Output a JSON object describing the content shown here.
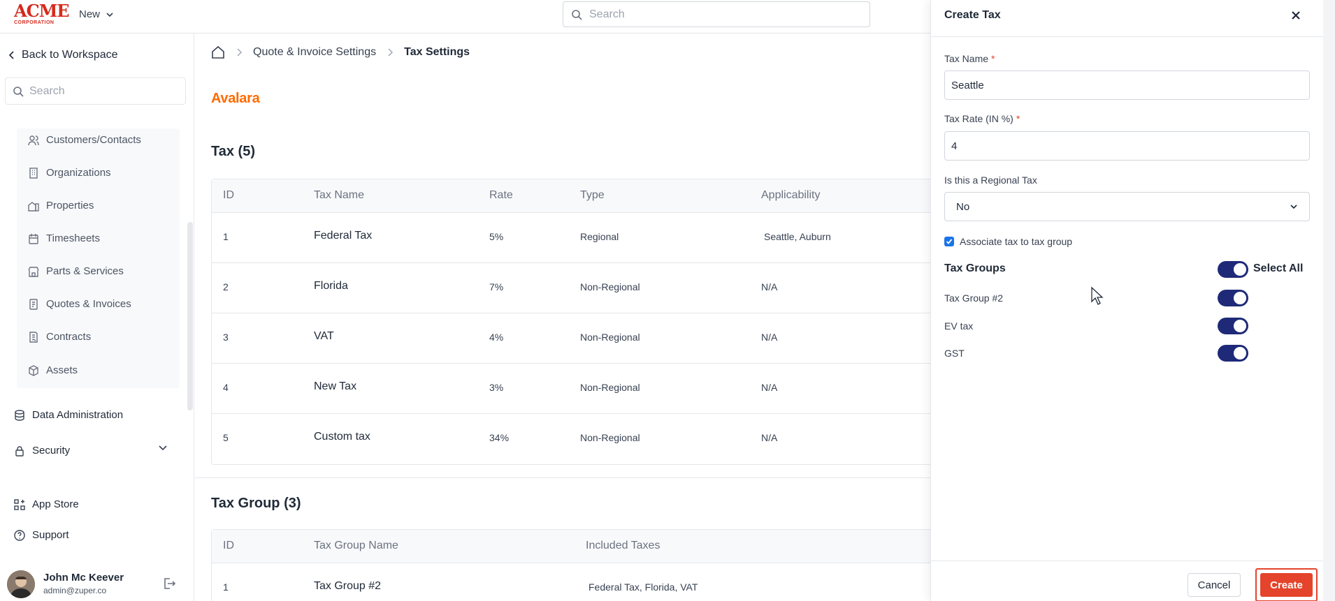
{
  "app": {
    "logo_main": "ACME",
    "logo_sub": "CORPORATION",
    "new_label": "New",
    "search_placeholder": "Search"
  },
  "sidebar": {
    "back_label": "Back to Workspace",
    "search_placeholder": "Search",
    "items": [
      {
        "label": "Customers/Contacts",
        "icon": "users-icon"
      },
      {
        "label": "Organizations",
        "icon": "building-icon"
      },
      {
        "label": "Properties",
        "icon": "property-icon"
      },
      {
        "label": "Timesheets",
        "icon": "calendar-icon"
      },
      {
        "label": "Parts & Services",
        "icon": "store-icon"
      },
      {
        "label": "Quotes & Invoices",
        "icon": "invoice-icon"
      },
      {
        "label": "Contracts",
        "icon": "contract-icon"
      },
      {
        "label": "Assets",
        "icon": "cube-icon"
      }
    ],
    "data_admin_label": "Data Administration",
    "security_label": "Security",
    "app_store_label": "App Store",
    "support_label": "Support",
    "user": {
      "name": "John Mc Keever",
      "email": "admin@zuper.co"
    }
  },
  "breadcrumb": {
    "items": [
      "Quote & Invoice Settings",
      "Tax Settings"
    ]
  },
  "main": {
    "brand": "Avalara",
    "tax_section_title": "Tax (5)",
    "tax_columns": [
      "ID",
      "Tax Name",
      "Rate",
      "Type",
      "Applicability"
    ],
    "tax_rows": [
      {
        "id": "1",
        "name": "Federal Tax",
        "rate": "5%",
        "type": "Regional",
        "applicability": "Seattle, Auburn"
      },
      {
        "id": "2",
        "name": "Florida",
        "rate": "7%",
        "type": "Non-Regional",
        "applicability": "N/A"
      },
      {
        "id": "3",
        "name": "VAT",
        "rate": "4%",
        "type": "Non-Regional",
        "applicability": "N/A"
      },
      {
        "id": "4",
        "name": "New Tax",
        "rate": "3%",
        "type": "Non-Regional",
        "applicability": "N/A"
      },
      {
        "id": "5",
        "name": "Custom tax",
        "rate": "34%",
        "type": "Non-Regional",
        "applicability": "N/A"
      }
    ],
    "group_section_title": "Tax Group (3)",
    "group_columns": [
      "ID",
      "Tax Group Name",
      "Included Taxes"
    ],
    "group_rows": [
      {
        "id": "1",
        "name": "Tax Group #2",
        "included": "Federal Tax, Florida, VAT"
      }
    ]
  },
  "panel": {
    "title": "Create Tax",
    "tax_name_label": "Tax Name",
    "tax_name_value": "Seattle",
    "tax_rate_label": "Tax Rate (IN %)",
    "tax_rate_value": "4",
    "required_mark": "*",
    "regional_label": "Is this a Regional Tax",
    "regional_value": "No",
    "associate_label": "Associate tax to tax group",
    "associate_checked": true,
    "groups_title": "Tax Groups",
    "select_all_label": "Select All",
    "select_all_on": true,
    "groups": [
      {
        "name": "Tax Group #2",
        "enabled": true
      },
      {
        "name": "EV tax",
        "enabled": true
      },
      {
        "name": "GST",
        "enabled": true
      }
    ],
    "cancel_label": "Cancel",
    "create_label": "Create"
  },
  "colors": {
    "brand_red": "#d42b1e",
    "accent_orange": "#e4442b",
    "toggle_on": "#1e2a78",
    "avalara_orange": "#ff6b00",
    "checkbox_blue": "#1a73e8"
  }
}
